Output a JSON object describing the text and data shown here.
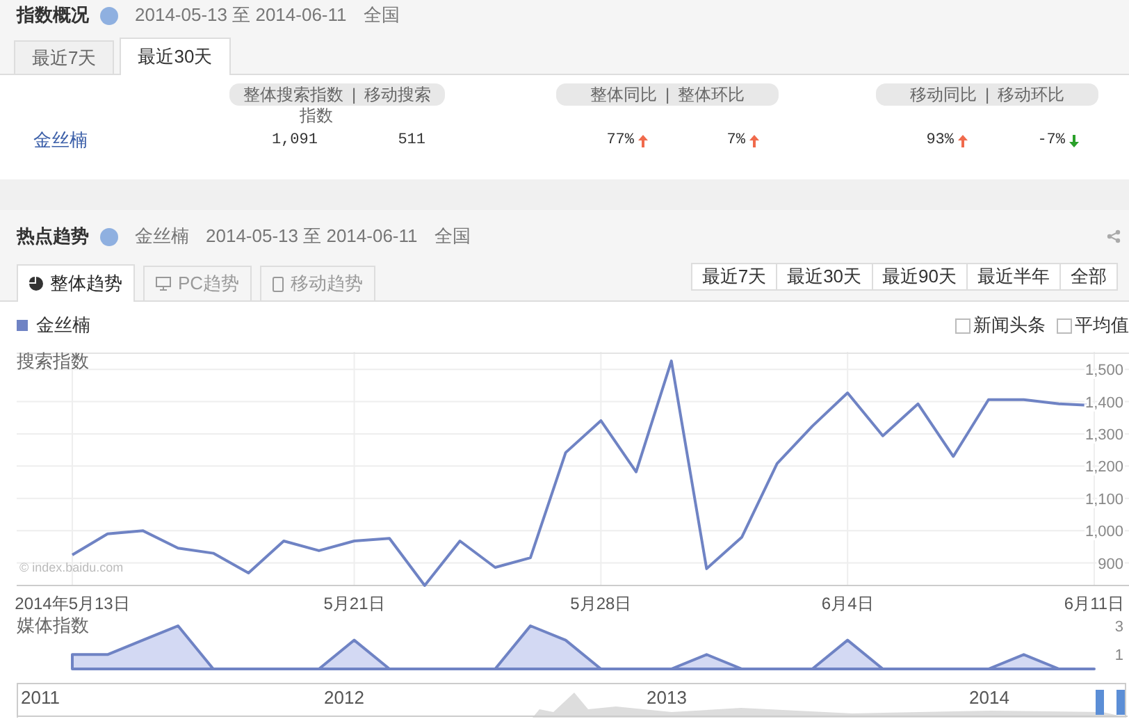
{
  "overview": {
    "title": "指数概况",
    "date_range": "2014-05-13 至 2014-06-11",
    "region": "全国",
    "tabs": [
      {
        "label": "最近7天",
        "selected": false
      },
      {
        "label": "最近30天",
        "selected": true
      }
    ],
    "column_groups": [
      {
        "left": "整体搜索指数",
        "separator": "|",
        "right": "移动搜索",
        "overflow": "指数"
      },
      {
        "left": "整体同比",
        "separator": "|",
        "right": "整体环比"
      },
      {
        "left": "移动同比",
        "separator": "|",
        "right": "移动环比"
      }
    ],
    "rows": [
      {
        "keyword": "金丝楠",
        "values": [
          {
            "text": "1,091"
          },
          {
            "text": "511"
          },
          {
            "text": "77%",
            "rising": true
          },
          {
            "text": "7%",
            "rising": true
          },
          {
            "text": "93%",
            "rising": true
          },
          {
            "text": "-7%",
            "rising": false
          }
        ]
      }
    ]
  },
  "trend": {
    "title": "热点趋势",
    "keyword": "金丝楠",
    "date_range": "2014-05-13 至 2014-06-11",
    "region": "全国",
    "tabs": [
      {
        "label": "整体趋势",
        "selected": true
      },
      {
        "label": "PC趋势",
        "selected": false
      },
      {
        "label": "移动趋势",
        "selected": false
      }
    ],
    "ranges": [
      "最近7天",
      "最近30天",
      "最近90天",
      "最近半年",
      "全部"
    ],
    "options": [
      {
        "label": "新闻头条",
        "checked": false
      },
      {
        "label": "平均值",
        "checked": false
      }
    ],
    "credit": "© index.baidu.com",
    "chart_data": {
      "type": "line",
      "ylabel": "搜索指数",
      "grid": true,
      "categories": [
        "2014年5月13日",
        null,
        null,
        null,
        null,
        null,
        null,
        null,
        "5月21日",
        null,
        null,
        null,
        null,
        null,
        null,
        "5月28日",
        null,
        null,
        null,
        null,
        null,
        null,
        "6月4日",
        null,
        null,
        null,
        null,
        null,
        null,
        "6月11日"
      ],
      "ylim": [
        830,
        1550
      ],
      "yticks": [
        {
          "value": 900,
          "label": "900"
        },
        {
          "value": 1000,
          "label": "1,000"
        },
        {
          "value": 1100,
          "label": "1,100"
        },
        {
          "value": 1200,
          "label": "1,200"
        },
        {
          "value": 1300,
          "label": "1,300"
        },
        {
          "value": 1400,
          "label": "1,400"
        },
        {
          "value": 1500,
          "label": "1,500"
        }
      ],
      "series": [
        {
          "name": "金丝楠",
          "color": "#6f83c4",
          "values": [
            925,
            990,
            1000,
            946,
            930,
            869,
            968,
            938,
            968,
            976,
            830,
            968,
            886,
            916,
            1242,
            1341,
            1182,
            1526,
            882,
            980,
            1208,
            1324,
            1427,
            1294,
            1393,
            1230,
            1406,
            1406,
            1393,
            1388
          ]
        }
      ]
    },
    "media": {
      "chart_data": {
        "type": "area",
        "categories": [
          null,
          null,
          null,
          null,
          null,
          null,
          null,
          null,
          null,
          null,
          null,
          null,
          null,
          null,
          null,
          null,
          null,
          null,
          null,
          null,
          null,
          null,
          null,
          null,
          null,
          null,
          null,
          null,
          null,
          null
        ],
        "ylim": [
          0,
          3
        ],
        "yticks": [
          1,
          3
        ],
        "series": [
          {
            "name": "媒体指数",
            "color": "#6f83c4",
            "values": [
              1,
              1,
              2,
              3,
              0,
              0,
              0,
              0,
              2,
              0,
              0,
              0,
              0,
              3,
              2,
              0,
              0,
              0,
              1,
              0,
              0,
              0,
              2,
              0,
              0,
              0,
              0,
              1,
              0,
              0
            ]
          }
        ]
      }
    },
    "navigator": {
      "labels": [
        "2011",
        "2012",
        "2013",
        "2014"
      ]
    }
  }
}
